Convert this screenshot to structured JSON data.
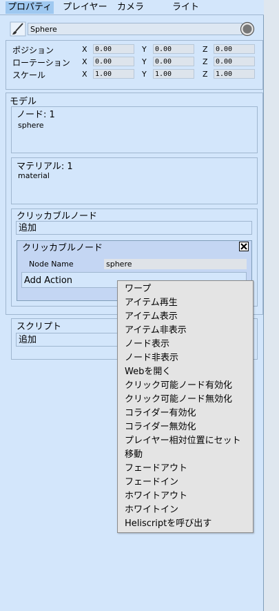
{
  "tabs": [
    "プロパティ",
    "プレイヤー",
    "カメラ",
    "ライト"
  ],
  "object_name": "Sphere",
  "transform": {
    "rows": [
      {
        "label": "ポジション",
        "x": "0.00",
        "y": "0.00",
        "z": "0.00"
      },
      {
        "label": "ローテーション",
        "x": "0.00",
        "y": "0.00",
        "z": "0.00"
      },
      {
        "label": "スケール",
        "x": "1.00",
        "y": "1.00",
        "z": "1.00"
      }
    ],
    "axes": [
      "X",
      "Y",
      "Z"
    ]
  },
  "model": {
    "title": "モデル",
    "node_label": "ノード: 1",
    "node_value": "sphere",
    "material_label": "マテリアル: 1",
    "material_value": "material"
  },
  "clickable": {
    "title": "クリッカブルノード",
    "add_label": "追加",
    "inner_title": "クリッカブルノード",
    "node_name_label": "Node Name",
    "node_name_value": "sphere",
    "add_action_label": "Add Action"
  },
  "script": {
    "title": "スクリプト",
    "add_label": "追加"
  },
  "menu_items": [
    "ワープ",
    "アイテム再生",
    "アイテム表示",
    "アイテム非表示",
    "ノード表示",
    "ノード非表示",
    "Webを開く",
    "クリック可能ノード有効化",
    "クリック可能ノード無効化",
    "コライダー有効化",
    "コライダー無効化",
    "プレイヤー相対位置にセット",
    "移動",
    "フェードアウト",
    "フェードイン",
    "ホワイトアウト",
    "ホワイトイン",
    "Heliscriptを呼び出す"
  ]
}
